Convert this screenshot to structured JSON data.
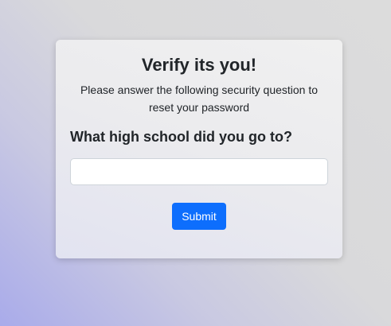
{
  "form": {
    "title": "Verify its you!",
    "subtitle": "Please answer the following security question to reset your password",
    "question": "What high school did you go to?",
    "answer_value": "",
    "answer_placeholder": "",
    "submit_label": "Submit"
  },
  "colors": {
    "primary_button": "#0d6efd",
    "button_text": "#ffffff",
    "text": "#212529"
  }
}
